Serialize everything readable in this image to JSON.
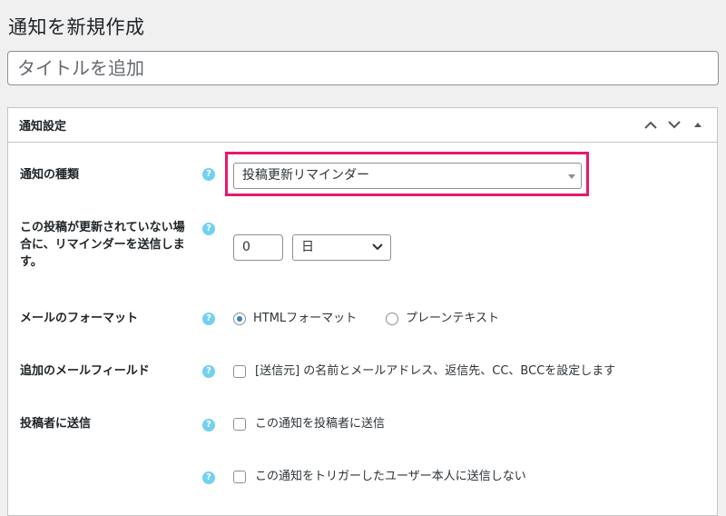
{
  "page": {
    "title": "通知を新規作成",
    "title_placeholder": "タイトルを追加"
  },
  "settings": {
    "box_title": "通知設定",
    "notification_type": {
      "label": "通知の種類",
      "selected": "投稿更新リマインダー"
    },
    "reminder": {
      "label_line1": "この投稿が更新されていない場",
      "label_line2": "合に、リマインダーを送信しま",
      "label_line3": "す。",
      "number_value": "0",
      "unit_selected": "日"
    },
    "mail_format": {
      "label": "メールのフォーマット",
      "options": [
        "HTMLフォーマット",
        "プレーンテキスト"
      ],
      "selected_index": 0
    },
    "extra_fields": {
      "label": "追加のメールフィールド",
      "checkbox_label": "[送信元] の名前とメールアドレス、返信先、CC、BCCを設定します"
    },
    "send_to_author": {
      "label": "投稿者に送信",
      "checkbox_label": "この通知を投稿者に送信"
    },
    "no_send_trigger_user": {
      "checkbox_label": "この通知をトリガーしたユーザー本人に送信しない"
    },
    "help_glyph": "?"
  },
  "colors": {
    "highlight": "#e8176c",
    "help_icon": "#72d1f0",
    "radio_checked": "#3582c4"
  },
  "icons": [
    "chevron-up-icon",
    "chevron-down-icon",
    "triangle-up-icon",
    "help-icon",
    "select-caret-icon"
  ]
}
